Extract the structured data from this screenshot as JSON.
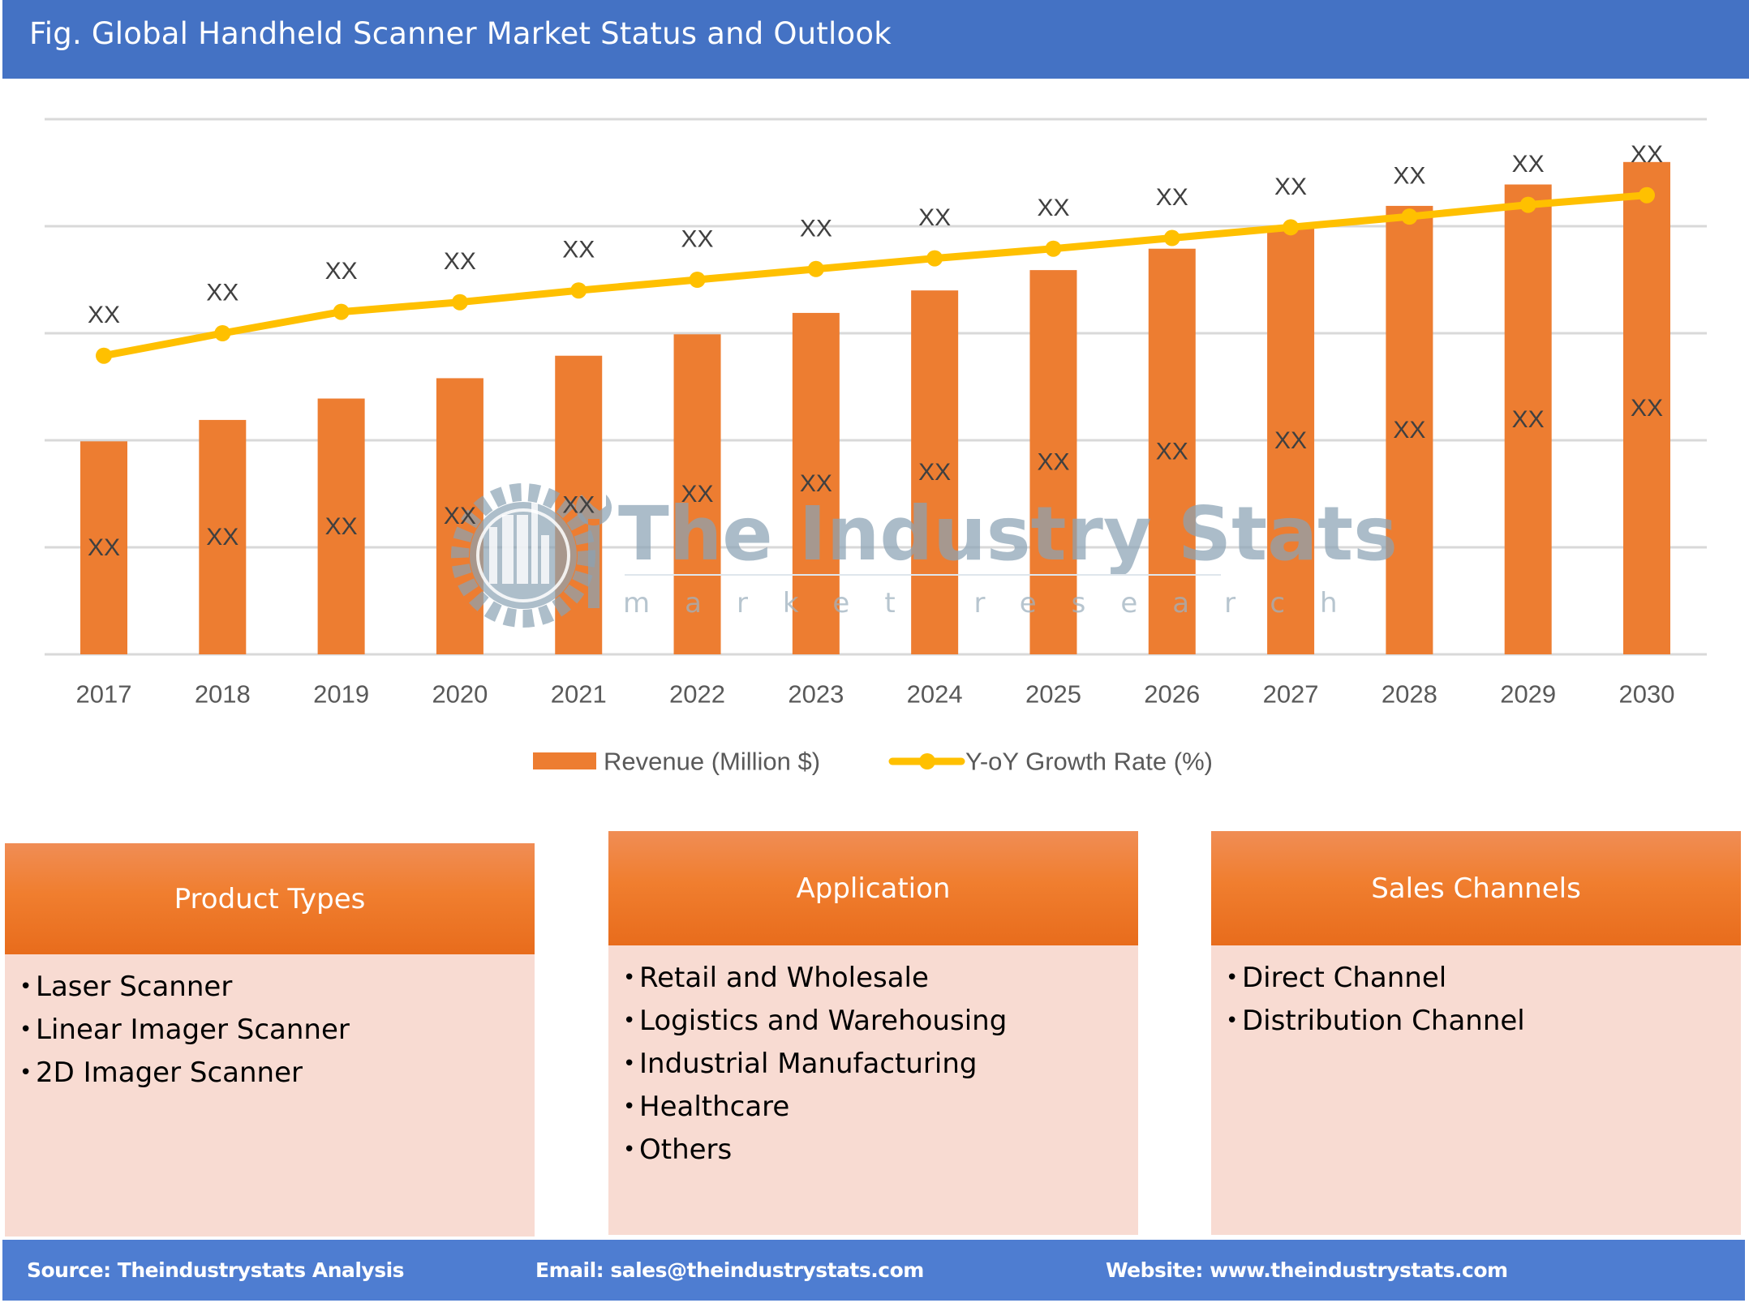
{
  "header": {
    "title": "Fig. Global Handheld Scanner Market Status and Outlook"
  },
  "colors": {
    "header_bg": "#4472c4",
    "revenue_bar": "#ed7d31",
    "growth_line": "#ffc000",
    "panel_header": "#f07e2f",
    "panel_body": "#f8dbd2",
    "footer_bg": "#4e7dd1"
  },
  "chart_data": {
    "type": "bar",
    "title": "Fig. Global Handheld Scanner Market Status and Outlook",
    "xlabel": "",
    "ylabel": "",
    "categories": [
      "2017",
      "2018",
      "2019",
      "2020",
      "2021",
      "2022",
      "2023",
      "2024",
      "2025",
      "2026",
      "2027",
      "2028",
      "2029",
      "2030"
    ],
    "value_units_note": "Axis is unlabeled; values are estimated in gridline units (5 equal intervals, 0–5). All data labels read 'XX'.",
    "ylim": [
      0,
      5
    ],
    "gridlines": 5,
    "grid": true,
    "legend_position": "bottom",
    "series": [
      {
        "name": "Revenue (Million $)",
        "type": "bar",
        "values": [
          1.99,
          2.19,
          2.39,
          2.58,
          2.79,
          2.99,
          3.19,
          3.4,
          3.59,
          3.79,
          3.99,
          4.19,
          4.39,
          4.6
        ],
        "labels": [
          "XX",
          "XX",
          "XX",
          "XX",
          "XX",
          "XX",
          "XX",
          "XX",
          "XX",
          "XX",
          "XX",
          "XX",
          "XX",
          "XX"
        ],
        "label_position": "center"
      },
      {
        "name": "Y-oY Growth Rate (%)",
        "type": "line",
        "values": [
          2.79,
          3.0,
          3.2,
          3.29,
          3.4,
          3.5,
          3.6,
          3.7,
          3.79,
          3.89,
          3.99,
          4.09,
          4.2,
          4.29
        ],
        "labels": [
          "XX",
          "XX",
          "XX",
          "XX",
          "XX",
          "XX",
          "XX",
          "XX",
          "XX",
          "XX",
          "XX",
          "XX",
          "XX",
          "XX"
        ],
        "label_position": "above"
      }
    ]
  },
  "watermark": {
    "title": "The Industry Stats",
    "subtitle": "market research",
    "icon": "gear-factory-wrench-logo"
  },
  "panels": [
    {
      "title": "Product Types",
      "items": [
        "Laser Scanner",
        "Linear Imager Scanner",
        "2D Imager Scanner"
      ]
    },
    {
      "title": "Application",
      "items": [
        "Retail and Wholesale",
        "Logistics and Warehousing",
        "Industrial Manufacturing",
        "Healthcare",
        "Others"
      ]
    },
    {
      "title": "Sales Channels",
      "items": [
        "Direct Channel",
        "Distribution Channel"
      ]
    }
  ],
  "bullet_glyph": "•",
  "footer": {
    "source": "Source: Theindustrystats Analysis",
    "email": "Email: sales@theindustrystats.com",
    "website": "Website: www.theindustrystats.com"
  }
}
